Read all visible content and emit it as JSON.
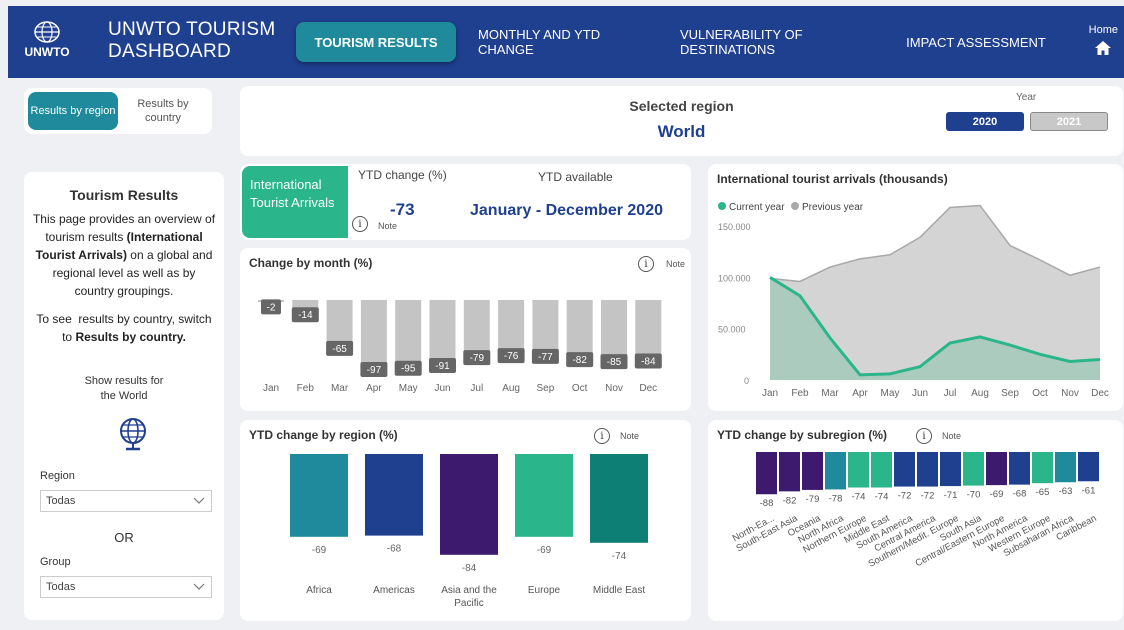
{
  "header": {
    "logo_text": "UNWTO",
    "title_line1": "UNWTO TOURISM",
    "title_line2": "DASHBOARD",
    "nav": [
      "TOURISM RESULTS",
      "MONTHLY AND YTD CHANGE",
      "VULNERABILITY OF DESTINATIONS",
      "IMPACT ASSESSMENT"
    ],
    "home_label": "Home"
  },
  "toggle": {
    "option1": "Results by region",
    "option2": "Results by country"
  },
  "selection": {
    "label": "Selected region",
    "value": "World",
    "year_label": "Year",
    "years": [
      "2020",
      "2021"
    ],
    "selected_year": "2020"
  },
  "left_panel": {
    "title": "Tourism Results",
    "region_label": "Region",
    "region_value": "Todas",
    "or_label": "OR",
    "group_label": "Group",
    "group_value": "Todas"
  },
  "kpi": {
    "tile_label": "International Tourist Arrivals",
    "ytd_change_label": "YTD change (%)",
    "ytd_change_value": "-73",
    "note_label": "Note",
    "ytd_available_label": "YTD available",
    "ytd_available_value": "January - December 2020"
  },
  "colors": {
    "navy": "#1f3f8f",
    "teal": "#1e8a9c",
    "green": "#2bb58a",
    "purple": "#3d1a6e",
    "darkteal": "#0e7f74",
    "gray": "#c4c4c4"
  },
  "chart_data": [
    {
      "type": "bar",
      "title": "Change by month (%)",
      "categories": [
        "Jan",
        "Feb",
        "Mar",
        "Apr",
        "May",
        "Jun",
        "Jul",
        "Aug",
        "Sep",
        "Oct",
        "Nov",
        "Dec"
      ],
      "values": [
        -2,
        -14,
        -65,
        -97,
        -95,
        -91,
        -79,
        -76,
        -77,
        -82,
        -85,
        -84
      ],
      "ylim": [
        -100,
        0
      ]
    },
    {
      "type": "area",
      "title": "International tourist arrivals (thousands)",
      "categories": [
        "Jan",
        "Feb",
        "Mar",
        "Apr",
        "May",
        "Jun",
        "Jul",
        "Aug",
        "Sep",
        "Oct",
        "Nov",
        "Dec"
      ],
      "yticks": [
        "150.000",
        "100.000",
        "50.000",
        "0"
      ],
      "ylim": [
        0,
        150000
      ],
      "legend": "top-left",
      "series": [
        {
          "name": "Current year",
          "values": [
            100000,
            82000,
            41000,
            5000,
            6000,
            13000,
            36000,
            42000,
            34000,
            25000,
            18000,
            20000
          ]
        },
        {
          "name": "Previous year",
          "values": [
            99000,
            96000,
            110000,
            118000,
            122000,
            139000,
            168000,
            170000,
            131000,
            117000,
            102000,
            110000
          ]
        }
      ]
    },
    {
      "type": "bar",
      "title": "YTD change by region (%)",
      "categories": [
        "Africa",
        "Americas",
        "Asia and the Pacific",
        "Europe",
        "Middle East"
      ],
      "values": [
        -69,
        -68,
        -84,
        -69,
        -74
      ],
      "ylim": [
        -100,
        0
      ]
    },
    {
      "type": "bar",
      "title": "YTD change by subregion (%)",
      "categories": [
        "North-Ea...",
        "South-East Asia",
        "Oceania",
        "North Africa",
        "Northern Europe",
        "Middle East",
        "South America",
        "Central America",
        "Southern/Medit. Europe",
        "South Asia",
        "Central/Eastern Europe",
        "North America",
        "Western Europe",
        "Subsaharan Africa",
        "Caribbean"
      ],
      "values": [
        -88,
        -82,
        -79,
        -78,
        -74,
        -74,
        -72,
        -72,
        -71,
        -70,
        -69,
        -68,
        -65,
        -63,
        -61
      ],
      "ylim": [
        -100,
        0
      ]
    }
  ]
}
